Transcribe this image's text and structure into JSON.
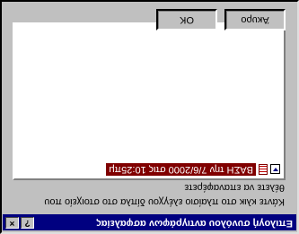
{
  "dialog": {
    "title": "Επιλογή συνόλου αντιγράφων ασφαλείας",
    "help_glyph": "?",
    "close_glyph": "×",
    "instructions_line1": "Κάντε κλικ στο πλαίσιο ελέγχου δίπλα στο στοιχείο που",
    "instructions_line2": "θέλετε να επαναφέρετε",
    "list": {
      "items": [
        {
          "label": "ΒΑΣΗ την 7/6/2000 στις 10:25πμ",
          "icon": "database-icon",
          "expander": "expand-icon"
        }
      ]
    },
    "buttons": {
      "ok": "OK",
      "cancel": "Άκυρο"
    }
  }
}
